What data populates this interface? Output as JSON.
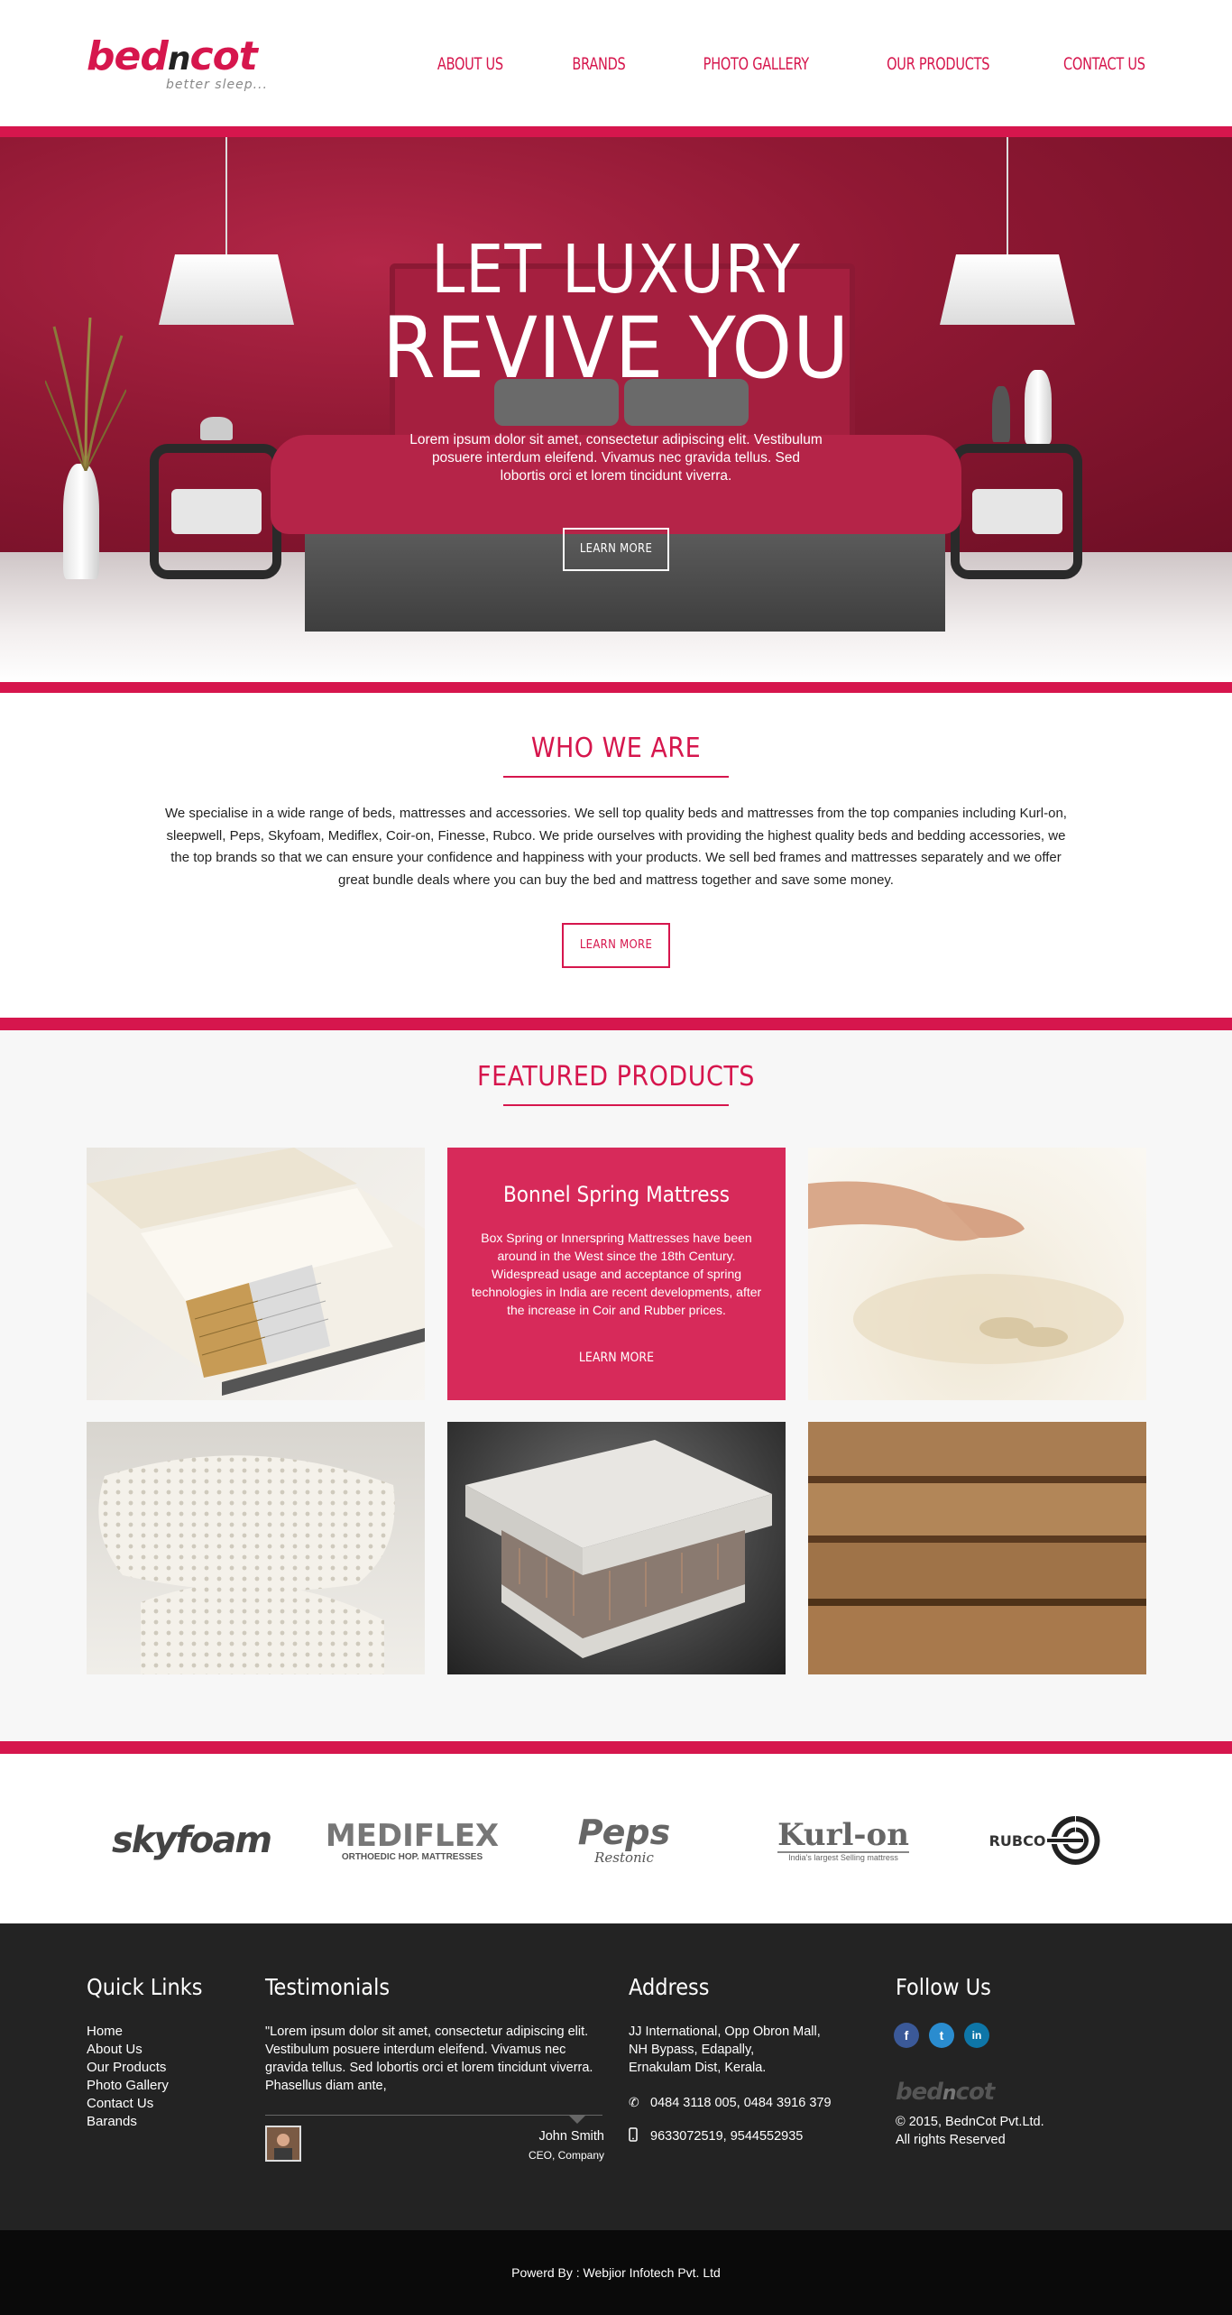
{
  "brand": {
    "logo_left": "bed",
    "logo_mid": "n",
    "logo_right": "cot",
    "tagline": "better sleep..."
  },
  "nav": [
    {
      "label": "ABOUT US"
    },
    {
      "label": "BRANDS"
    },
    {
      "label": "PHOTO GALLERY"
    },
    {
      "label": "OUR PRODUCTS"
    },
    {
      "label": "CONTACT US"
    }
  ],
  "hero": {
    "title_line1": "LET LUXURY",
    "title_line2": "REVIVE YOU",
    "text": "Lorem ipsum dolor sit amet, consectetur adipiscing elit. Vestibulum posuere interdum eleifend. Vivamus nec gravida tellus. Sed lobortis orci et lorem tincidunt viverra.",
    "button": "LEARN MORE"
  },
  "about": {
    "title": "WHO WE ARE",
    "text": "We specialise in a wide range of beds, mattresses and accessories. We sell top quality beds and mattresses from the top companies including Kurl-on, sleepwell, Peps, Skyfoam, Mediflex, Coir-on, Finesse, Rubco. We pride ourselves with providing the highest quality beds and bedding accessories, we the top brands so that we can ensure your confidence and happiness with your products. We sell bed frames and mattresses separately and we offer great bundle deals where you can buy the bed and mattress together and save some money.",
    "button": "LEARN MORE"
  },
  "featured": {
    "title": "FEATURED PRODUCTS",
    "promo": {
      "title": "Bonnel Spring Mattress",
      "text": "Box Spring or Innerspring Mattresses have been around in the West since the 18th Century. Widespread usage and acceptance of spring technologies in India are recent developments, after the increase in Coir and Rubber prices.",
      "link": "LEARN MORE"
    }
  },
  "brands": {
    "skyfoam": "skyfoam",
    "mediflex": "MEDIFLEX",
    "mediflex_sub": "ORTHOEDIC HOP. MATTRESSES",
    "peps": "Peps",
    "peps_sub": "Restonic",
    "kurlon": "Kurl-on",
    "kurlon_sub": "India's largest Selling mattress",
    "rubco": "RUBCO"
  },
  "footer": {
    "quick_links_title": "Quick Links",
    "quick_links": [
      "Home",
      "About Us",
      "Our Products",
      "Photo Gallery",
      "Contact Us",
      "Barands"
    ],
    "testimonials_title": "Testimonials",
    "testimonial_text": "\"Lorem ipsum dolor sit amet, consectetur adipiscing elit. Vestibulum posuere interdum eleifend. Vivamus nec gravida tellus. Sed lobortis orci et lorem tincidunt viverra. Phasellus diam ante,",
    "testimonial_name": "John Smith",
    "testimonial_role": "CEO, Company",
    "address_title": "Address",
    "address_lines": [
      "JJ International, Opp Obron Mall,",
      "NH Bypass, Edapally,",
      "Ernakulam Dist, Kerala."
    ],
    "phone": "0484 3118 005,  0484 3916 379",
    "mobile": "9633072519, 9544552935",
    "follow_title": "Follow Us",
    "social": [
      "f",
      "t",
      "in"
    ],
    "logo_left": "bed",
    "logo_mid": "n",
    "logo_right": "cot",
    "copyright": "© 2015, BednCot Pvt.Ltd.",
    "rights": "All rights Reserved"
  },
  "powered_by": "Powerd By : Webjior Infotech Pvt. Ltd",
  "colors": {
    "accent": "#d6164d",
    "footer_bg": "#232323",
    "bottom_bar": "#0a0a0a"
  }
}
